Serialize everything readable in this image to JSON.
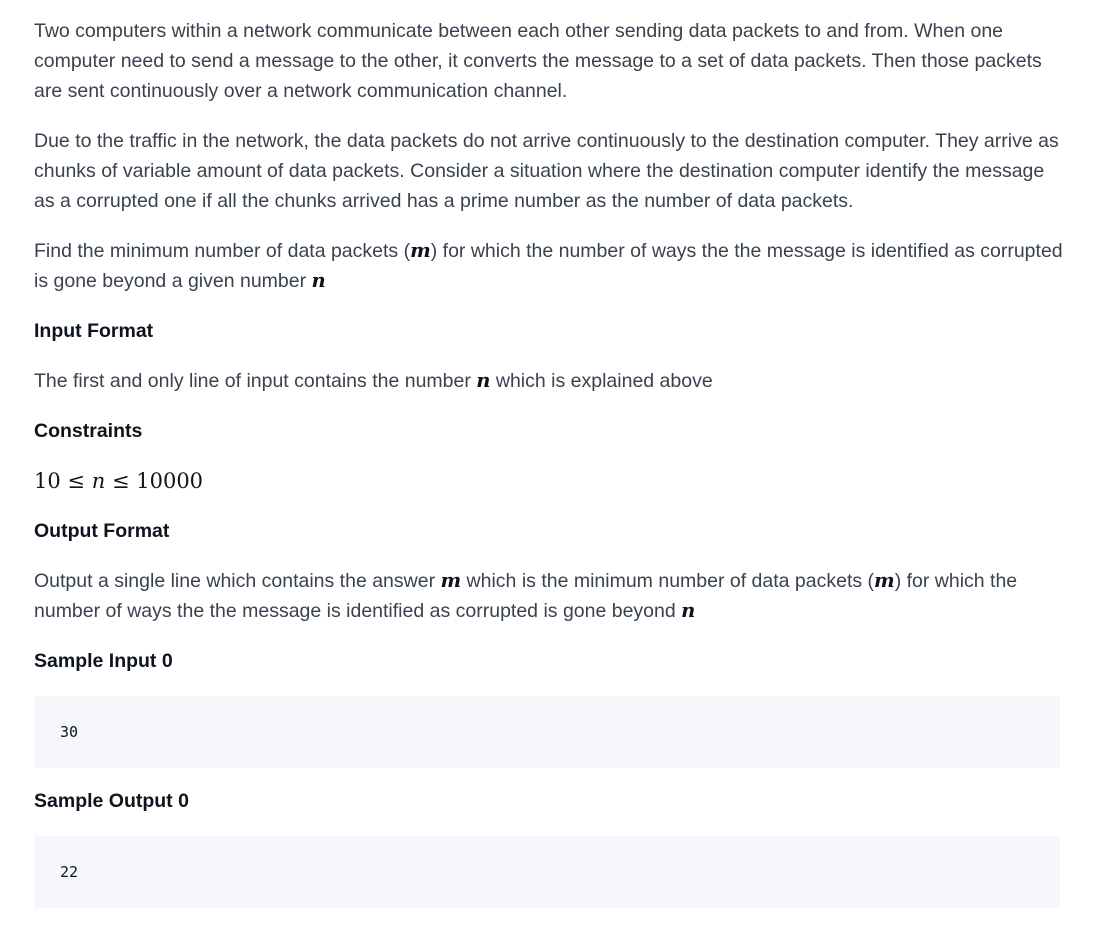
{
  "problem": {
    "paragraphs": {
      "p1": "Two computers within a network communicate between each other sending data packets to and from. When one computer need to send a message to the other, it converts the message to a set of data packets. Then those packets are sent continuously over a network communication channel.",
      "p2": "Due to the traffic in the network, the data packets do not arrive continuously to the destination computer. They arrive as chunks of variable amount of data packets. Consider a situation where the destination computer identify the message as a corrupted one if all the chunks arrived has a prime number as the number of data packets.",
      "p3_pre": "Find the minimum number of data packets (",
      "p3_var_m": "m",
      "p3_mid": ") for which the number of ways the the message is identified as corrupted is gone beyond a given number ",
      "p3_var_n": "n"
    },
    "input_format": {
      "heading": "Input Format",
      "text_pre": "The first and only line of input contains the number ",
      "var_n": "n",
      "text_post": " which is explained above"
    },
    "constraints": {
      "heading": "Constraints",
      "lower": "10",
      "leq1": "≤",
      "var": "n",
      "leq2": "≤",
      "upper": "10000"
    },
    "output_format": {
      "heading": "Output Format",
      "text_pre": "Output a single line which contains the answer ",
      "var_m1": "m",
      "text_mid": " which is the minimum number of data packets (",
      "var_m2": "m",
      "text_mid2": ") for which the number of ways the the message is identified as corrupted is gone beyond ",
      "var_n": "n"
    },
    "sample_input": {
      "heading": "Sample Input 0",
      "value": "30"
    },
    "sample_output": {
      "heading": "Sample Output 0",
      "value": "22"
    }
  }
}
